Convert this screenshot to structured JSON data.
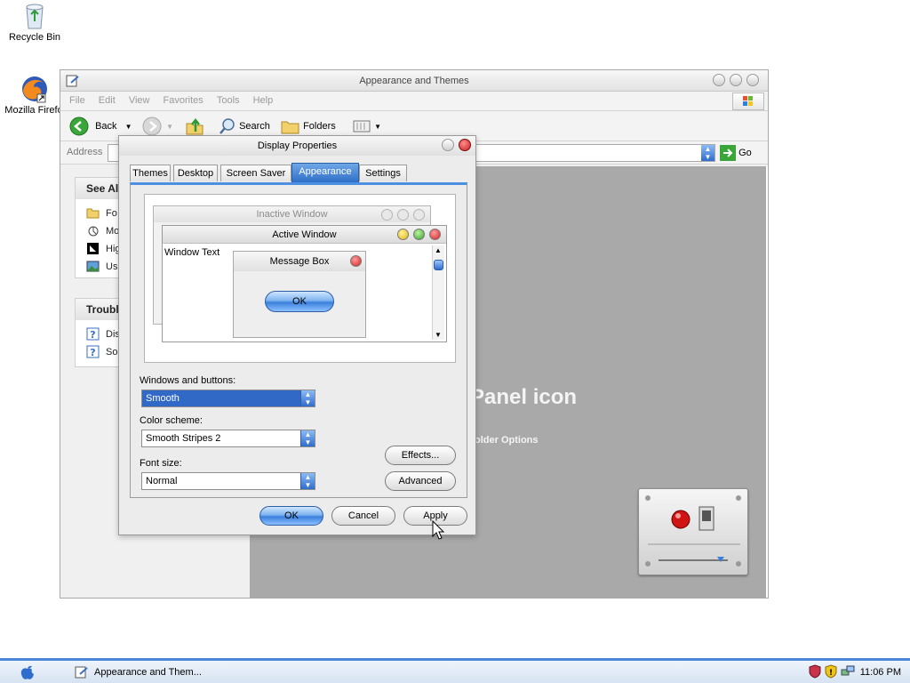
{
  "desktop": {
    "icons": [
      {
        "label": "Recycle Bin",
        "icon": "recycle-bin-icon"
      },
      {
        "label": "Mozilla Firefo",
        "icon": "firefox-icon"
      }
    ]
  },
  "explorer": {
    "title": "Appearance and Themes",
    "menu": [
      "File",
      "Edit",
      "View",
      "Favorites",
      "Tools",
      "Help"
    ],
    "toolbar": {
      "back": "Back",
      "search": "Search",
      "folders": "Folders"
    },
    "address_label": "Address",
    "go_label": "Go",
    "left_pane": {
      "see_also": {
        "title": "See Al",
        "items": [
          "Fo",
          "Mo",
          "Hig",
          "Us"
        ]
      },
      "troubleshooters": {
        "title": "Troubl",
        "items": [
          "Dis",
          "So"
        ]
      }
    },
    "right_pane": {
      "heading": "Panel icon",
      "link": "older Options"
    }
  },
  "dialog": {
    "title": "Display Properties",
    "tabs": [
      "Themes",
      "Desktop",
      "Screen Saver",
      "Appearance",
      "Settings"
    ],
    "active_tab": "Appearance",
    "preview": {
      "inactive_title": "Inactive Window",
      "active_title": "Active Window",
      "window_text": "Window Text",
      "message_box_title": "Message Box",
      "ok": "OK"
    },
    "windows_buttons_label": "Windows and buttons:",
    "windows_buttons_value": "Smooth",
    "color_scheme_label": "Color scheme:",
    "color_scheme_value": "Smooth Stripes 2",
    "font_size_label": "Font size:",
    "font_size_value": "Normal",
    "effects_button": "Effects...",
    "advanced_button": "Advanced",
    "ok_button": "OK",
    "cancel_button": "Cancel",
    "apply_button": "Apply"
  },
  "taskbar": {
    "task_label": "Appearance and Them...",
    "clock": "11:06 PM"
  },
  "colors": {
    "accent": "#3a80dc",
    "taskbar_border": "#4c86d6",
    "control_panel_bg": "#a9a9a9"
  }
}
